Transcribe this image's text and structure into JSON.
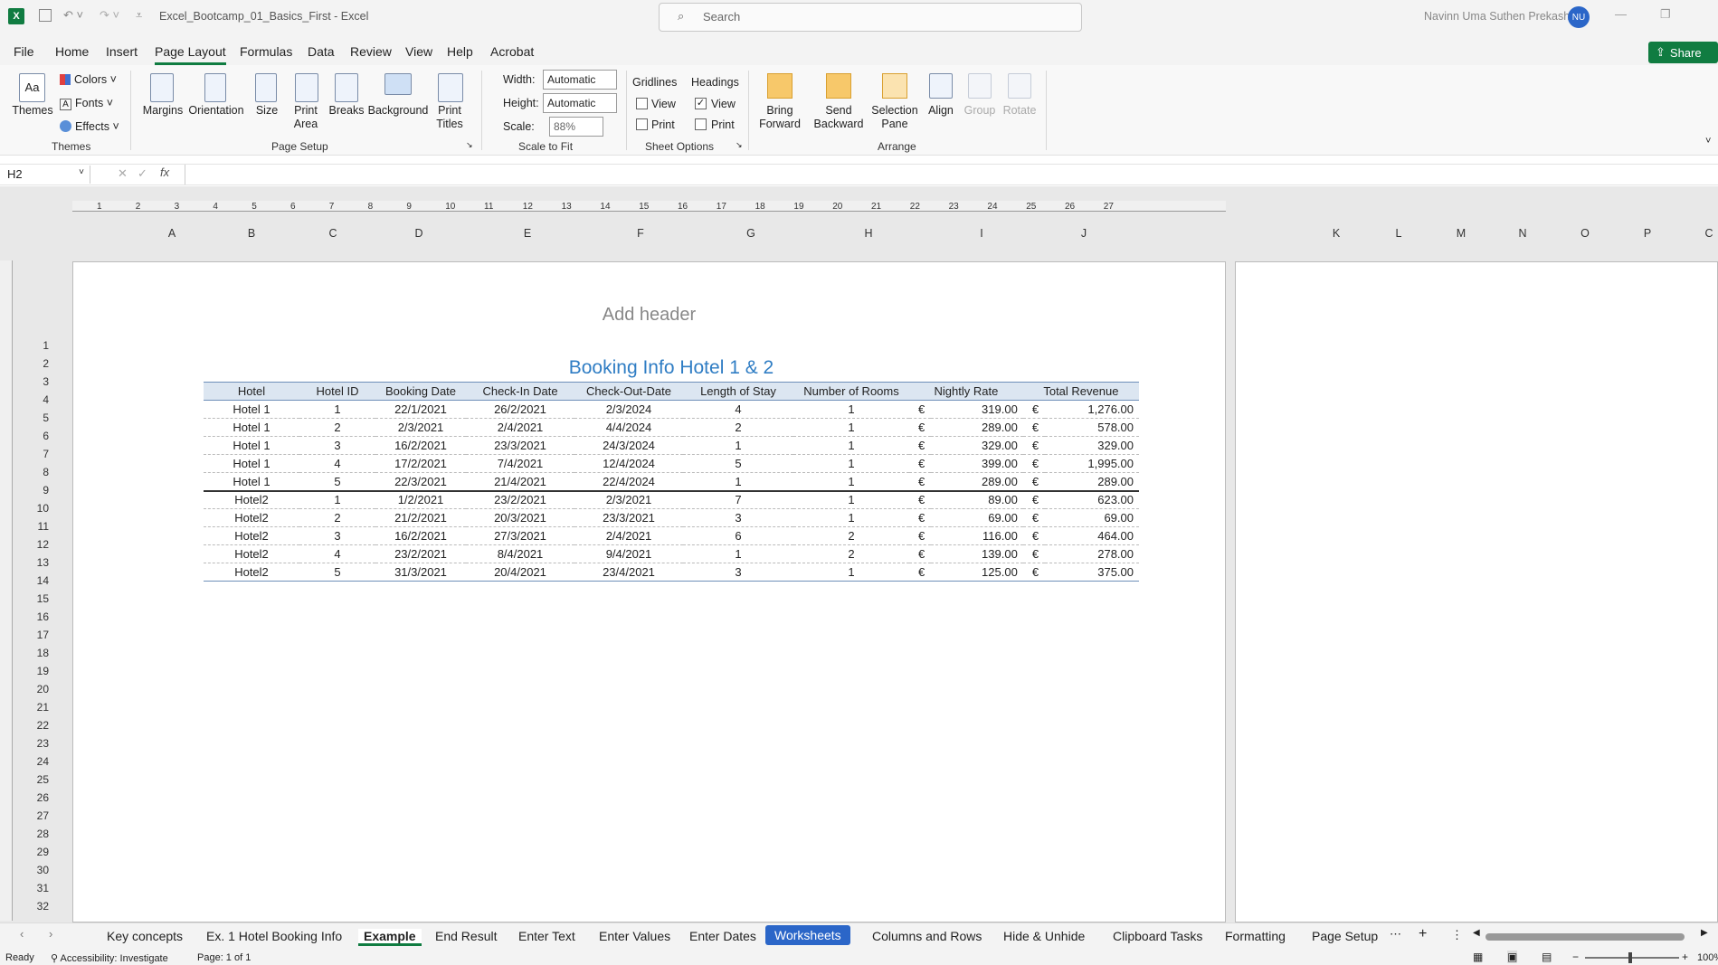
{
  "window": {
    "title": "Excel_Bootcamp_01_Basics_First  -  Excel",
    "search_placeholder": "Search",
    "user": "Navinn Uma Suthen Prekash",
    "avatar": "NU"
  },
  "menu": [
    "File",
    "Home",
    "Insert",
    "Page Layout",
    "Formulas",
    "Data",
    "Review",
    "View",
    "Help",
    "Acrobat"
  ],
  "share": "Share",
  "ribbon": {
    "themes": {
      "themes": "Themes",
      "colors": "Colors",
      "fonts": "Fonts",
      "effects": "Effects",
      "group": "Themes"
    },
    "page_setup": {
      "margins": "Margins",
      "orientation": "Orientation",
      "size": "Size",
      "print_area": "Print Area",
      "breaks": "Breaks",
      "background": "Background",
      "print_titles": "Print Titles",
      "group": "Page Setup"
    },
    "scale": {
      "width_label": "Width:",
      "width_value": "Automatic",
      "height_label": "Height:",
      "height_value": "Automatic",
      "scale_label": "Scale:",
      "scale_value": "88%",
      "group": "Scale to Fit"
    },
    "sheet_options": {
      "gridlines": "Gridlines",
      "headings": "Headings",
      "view": "View",
      "print": "Print",
      "group": "Sheet Options",
      "gridlines_view": false,
      "gridlines_print": false,
      "headings_view": true,
      "headings_print": false
    },
    "arrange": {
      "bring_forward": "Bring Forward",
      "send_backward": "Send Backward",
      "selection_pane": "Selection Pane",
      "align": "Align",
      "group_btn": "Group",
      "rotate": "Rotate",
      "group": "Arrange"
    }
  },
  "name_box": "H2",
  "ruler_numbers": [
    "1",
    "2",
    "3",
    "4",
    "5",
    "6",
    "7",
    "8",
    "9",
    "10",
    "11",
    "12",
    "13",
    "14",
    "15",
    "16",
    "17",
    "18",
    "19",
    "20",
    "21",
    "22",
    "23",
    "24",
    "25",
    "26",
    "27"
  ],
  "columns": [
    "A",
    "B",
    "C",
    "D",
    "E",
    "F",
    "G",
    "H",
    "I",
    "J",
    "K",
    "L",
    "M",
    "N",
    "O",
    "P",
    "C"
  ],
  "rows": [
    "1",
    "2",
    "3",
    "4",
    "5",
    "6",
    "7",
    "8",
    "9",
    "10",
    "11",
    "12",
    "13",
    "14",
    "15",
    "16",
    "17",
    "18",
    "19",
    "20",
    "21",
    "22",
    "23",
    "24",
    "25",
    "26",
    "27",
    "28",
    "29",
    "30",
    "31",
    "32"
  ],
  "page": {
    "add_header": "Add header",
    "title": "Booking Info Hotel 1 & 2"
  },
  "table": {
    "headers": [
      "Hotel",
      "Hotel ID",
      "Booking Date",
      "Check-In Date",
      "Check-Out-Date",
      "Length of Stay",
      "Number of Rooms",
      "Nightly Rate",
      "Total Revenue"
    ],
    "currency": "€",
    "rows": [
      [
        "Hotel 1",
        "1",
        "22/1/2021",
        "26/2/2021",
        "2/3/2024",
        "4",
        "1",
        "319.00",
        "1,276.00"
      ],
      [
        "Hotel 1",
        "2",
        "2/3/2021",
        "2/4/2021",
        "4/4/2024",
        "2",
        "1",
        "289.00",
        "578.00"
      ],
      [
        "Hotel 1",
        "3",
        "16/2/2021",
        "23/3/2021",
        "24/3/2024",
        "1",
        "1",
        "329.00",
        "329.00"
      ],
      [
        "Hotel 1",
        "4",
        "17/2/2021",
        "7/4/2021",
        "12/4/2024",
        "5",
        "1",
        "399.00",
        "1,995.00"
      ],
      [
        "Hotel 1",
        "5",
        "22/3/2021",
        "21/4/2021",
        "22/4/2024",
        "1",
        "1",
        "289.00",
        "289.00"
      ],
      [
        "Hotel2",
        "1",
        "1/2/2021",
        "23/2/2021",
        "2/3/2021",
        "7",
        "1",
        "89.00",
        "623.00"
      ],
      [
        "Hotel2",
        "2",
        "21/2/2021",
        "20/3/2021",
        "23/3/2021",
        "3",
        "1",
        "69.00",
        "69.00"
      ],
      [
        "Hotel2",
        "3",
        "16/2/2021",
        "27/3/2021",
        "2/4/2021",
        "6",
        "2",
        "116.00",
        "464.00"
      ],
      [
        "Hotel2",
        "4",
        "23/2/2021",
        "8/4/2021",
        "9/4/2021",
        "1",
        "2",
        "139.00",
        "278.00"
      ],
      [
        "Hotel2",
        "5",
        "31/3/2021",
        "20/4/2021",
        "23/4/2021",
        "3",
        "1",
        "125.00",
        "375.00"
      ]
    ]
  },
  "tabs": [
    "Key concepts",
    "Ex. 1 Hotel Booking Info",
    "Example",
    "End Result",
    "Enter Text",
    "Enter Values",
    "Enter Dates",
    "Worksheets",
    "Columns and Rows",
    "Hide & Unhide",
    "Clipboard Tasks",
    "Formatting",
    "Page Setup"
  ],
  "status": {
    "ready": "Ready",
    "accessibility": "Accessibility: Investigate",
    "page": "Page: 1 of 1",
    "zoom": "100%"
  }
}
